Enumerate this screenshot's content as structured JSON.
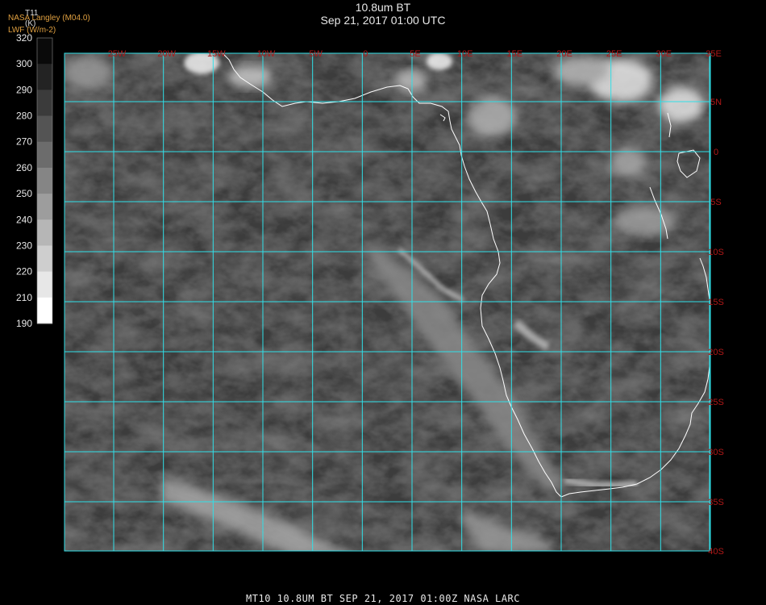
{
  "header": {
    "title": "10.8um BT",
    "subtitle": "Sep 21, 2017 01:00 UTC",
    "org_line1": "NASA Langley (M04.0)",
    "org_line2": "LWF (W/m-2)"
  },
  "colorbar": {
    "variable": "T11",
    "unit": "(K)",
    "ticks": [
      "320",
      "300",
      "290",
      "280",
      "270",
      "260",
      "250",
      "240",
      "230",
      "220",
      "210",
      "190"
    ]
  },
  "map": {
    "lon_labels": [
      "25W",
      "20W",
      "15W",
      "10W",
      "5W",
      "0",
      "5E",
      "10E",
      "15E",
      "20E",
      "25E",
      "30E",
      "35E"
    ],
    "lat_labels": [
      "5N",
      "0",
      "5S",
      "10S",
      "15S",
      "20S",
      "25S",
      "30S",
      "35S",
      "40S"
    ],
    "grid_color": "#30e0e8",
    "coast_color": "#ffffff",
    "label_color": "#b01818"
  },
  "footer": {
    "text": "MT10  10.8UM BT   SEP 21, 2017 01:00Z   NASA LARC"
  }
}
